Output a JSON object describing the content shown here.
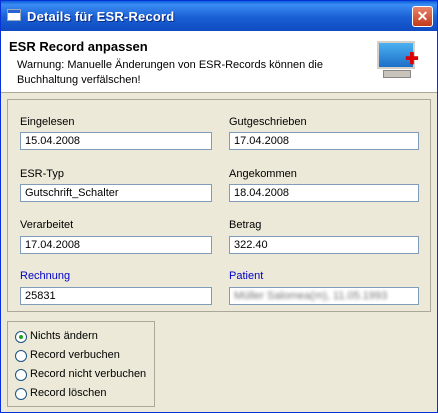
{
  "window": {
    "title": "Details für ESR-Record",
    "close_label": "✕"
  },
  "header": {
    "title": "ESR Record anpassen",
    "warning": "Warnung: Manuelle Änderungen von ESR-Records können die Buchhaltung verfälschen!",
    "icon": "monitor-plus-icon"
  },
  "fields": {
    "eingelesen": {
      "label": "Eingelesen",
      "value": "15.04.2008"
    },
    "gutgeschrieben": {
      "label": "Gutgeschrieben",
      "value": "17.04.2008"
    },
    "esr_typ": {
      "label": "ESR-Typ",
      "value": "Gutschrift_Schalter"
    },
    "angekommen": {
      "label": "Angekommen",
      "value": "18.04.2008"
    },
    "verarbeitet": {
      "label": "Verarbeitet",
      "value": "17.04.2008"
    },
    "betrag": {
      "label": "Betrag",
      "value": "322.40"
    },
    "rechnung": {
      "label": "Rechnung",
      "value": "25831"
    },
    "patient": {
      "label": "Patient",
      "value": "Müller Salomea(m), 11.05.1993"
    }
  },
  "link_color": "#0000cc",
  "radio_options": [
    {
      "label": "Nichts ändern",
      "checked": true
    },
    {
      "label": "Record verbuchen",
      "checked": false
    },
    {
      "label": "Record nicht verbuchen",
      "checked": false
    },
    {
      "label": "Record löschen",
      "checked": false
    }
  ]
}
